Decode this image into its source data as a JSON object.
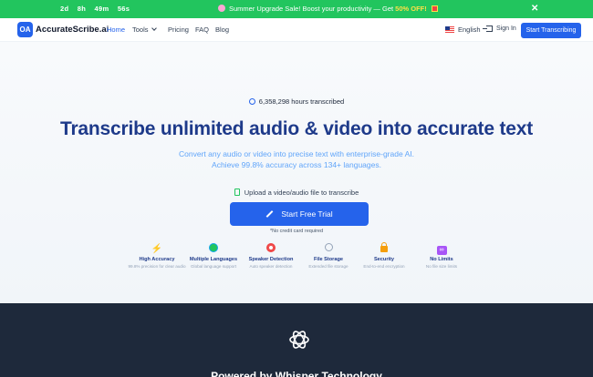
{
  "promo": {
    "countdown": [
      "2d",
      "8h",
      "49m",
      "56s"
    ],
    "message": "Summer Upgrade Sale! Boost your productivity — Get",
    "offer": "50% OFF!",
    "close_symbol": "✕"
  },
  "nav": {
    "logo_mark": "OA",
    "logo_text": "AccurateScribe.ai",
    "links": [
      "Home",
      "Tools",
      "Pricing",
      "FAQ",
      "Blog"
    ],
    "language": "English",
    "sign_in": "Sign In",
    "cta": "Start Transcribing"
  },
  "hero": {
    "stat": "6,358,298 hours transcribed",
    "headline": "Transcribe unlimited audio & video into accurate text",
    "subheadline": "Convert any audio or video into precise text with enterprise-grade AI. Achieve 99.8% accuracy across 134+ languages.",
    "upload_prompt": "Upload a video/audio file to transcribe",
    "cta": "Start Free Trial",
    "note": "*No credit card required"
  },
  "features": [
    {
      "title": "High Accuracy",
      "desc": "99.8% precision for clear audio",
      "icon": "lightning-icon"
    },
    {
      "title": "Multiple Languages",
      "desc": "Global language support",
      "icon": "globe-icon"
    },
    {
      "title": "Speaker Detection",
      "desc": "Auto speaker detection",
      "icon": "target-icon"
    },
    {
      "title": "File Storage",
      "desc": "Extended file storage",
      "icon": "stopwatch-icon"
    },
    {
      "title": "Security",
      "desc": "End-to-end encryption",
      "icon": "lock-icon"
    },
    {
      "title": "No Limits",
      "desc": "No file size limits",
      "icon": "infinity-icon"
    }
  ],
  "dark_section": {
    "title": "Powered by Whisper Technology",
    "icon": "openai-logo-icon"
  },
  "colors": {
    "promo_bg": "#22c55e",
    "primary": "#2563eb",
    "headline": "#1e3a8a",
    "subheadline": "#60a5fa",
    "dark_bg": "#1e293b"
  }
}
